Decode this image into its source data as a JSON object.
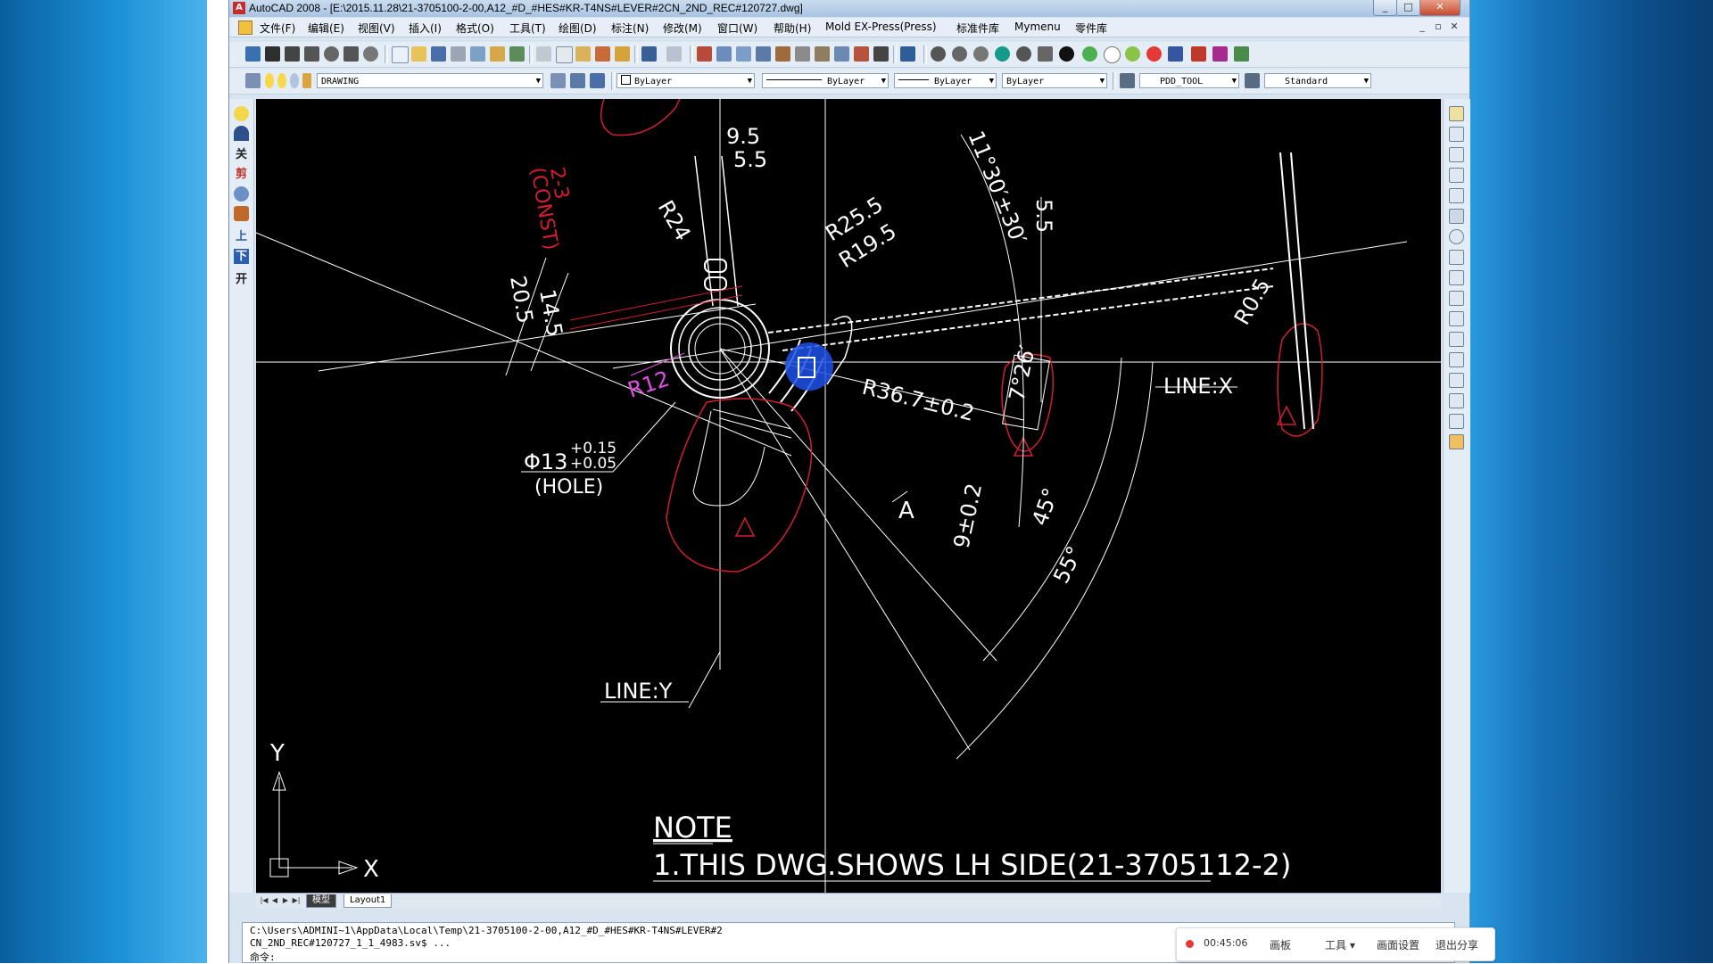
{
  "window": {
    "title": "AutoCAD 2008 - [E:\\2015.11.28\\21-3705100-2-00,A12_#D_#HES#KR-T4NS#LEVER#2CN_2ND_REC#120727.dwg]",
    "controls": {
      "minimize": "_",
      "maximize": "□",
      "close": "✕"
    }
  },
  "menubar": {
    "items": [
      "文件(F)",
      "编辑(E)",
      "视图(V)",
      "插入(I)",
      "格式(O)",
      "工具(T)",
      "绘图(D)",
      "标注(N)",
      "修改(M)",
      "窗口(W)",
      "帮助(H)",
      "Mold EX-Press(Press)",
      "标准件库",
      "Mymenu",
      "零件库"
    ],
    "mdi": [
      "_",
      "▫",
      "✕"
    ]
  },
  "properties_bar": {
    "layer": "DRAWING",
    "color": "ByLayer",
    "linetype": "ByLayer",
    "lineweight": "ByLayer",
    "plotstyle": "ByLayer",
    "text_style": "PDD_TOOL",
    "dim_style": "Standard"
  },
  "left_toolbar": {
    "glyphs": [
      "关",
      "剪",
      "上",
      "下",
      "开"
    ]
  },
  "drawing": {
    "dims": {
      "d9_5": "9.5",
      "d5_5_top": "5.5",
      "r24": "R24",
      "r25_5": "R25.5",
      "r19_5": "R19.5",
      "angle_11_30": "11°30′±30′",
      "d5_5_right": "5.5",
      "r0_5": "R0.5",
      "const_top": "2-3",
      "const_bottom": "(CONST)",
      "d20_5": "20.5",
      "d14_5": "14.5",
      "r12": "R12",
      "line_x": "LINE:X",
      "angle_7_26": "7°26′",
      "r36_7": "R36.7±0.2",
      "phi13": "Φ13",
      "tol_plus": "+0.15",
      "tol_minus": "+0.05",
      "hole": "(HOLE)",
      "view_a": "A",
      "d9_02": "9±0.2",
      "angle_45": "45°",
      "angle_55": "55°",
      "line_y": "LINE:Y"
    },
    "note_title": "NOTE",
    "note_line": "1.THIS DWG.SHOWS LH SIDE(21-3705112-2)",
    "ucs_x": "X",
    "ucs_y": "Y"
  },
  "tabs": {
    "model": "模型",
    "layout": "Layout1"
  },
  "command": {
    "line1": "C:\\Users\\ADMINI~1\\AppData\\Local\\Temp\\21-3705100-2-00,A12_#D_#HES#KR-T4NS#LEVER#2",
    "line2": "CN_2ND_REC#120727_1_1_4983.sv$ ...",
    "line3": "命令:"
  },
  "recorder": {
    "time": "00:45:06",
    "items": [
      "画板",
      "工具 ▾",
      "画面设置",
      "退出分享"
    ]
  }
}
